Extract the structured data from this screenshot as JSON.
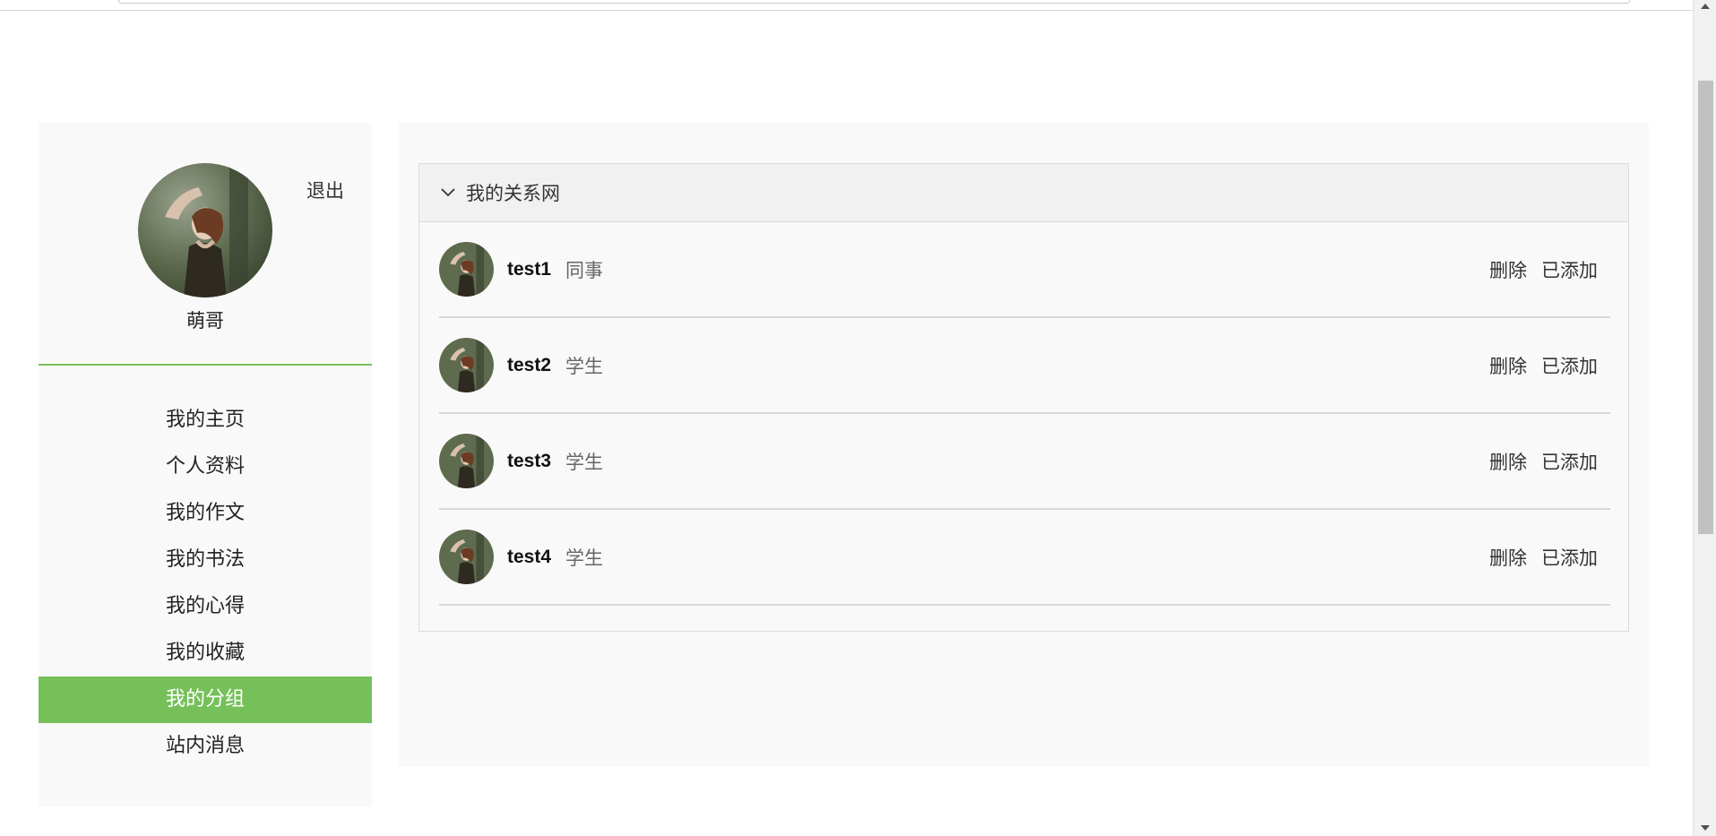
{
  "sidebar": {
    "logout_label": "退出",
    "username": "萌哥",
    "nav": [
      {
        "label": "我的主页",
        "active": false
      },
      {
        "label": "个人资料",
        "active": false
      },
      {
        "label": "我的作文",
        "active": false
      },
      {
        "label": "我的书法",
        "active": false
      },
      {
        "label": "我的心得",
        "active": false
      },
      {
        "label": "我的收藏",
        "active": false
      },
      {
        "label": "我的分组",
        "active": true
      },
      {
        "label": "站内消息",
        "active": false
      }
    ],
    "accent_color": "#76c05a"
  },
  "panel": {
    "title": "我的关系网",
    "rows": [
      {
        "name": "test1",
        "tag": "同事",
        "delete_label": "删除",
        "added_label": "已添加"
      },
      {
        "name": "test2",
        "tag": "学生",
        "delete_label": "删除",
        "added_label": "已添加"
      },
      {
        "name": "test3",
        "tag": "学生",
        "delete_label": "删除",
        "added_label": "已添加"
      },
      {
        "name": "test4",
        "tag": "学生",
        "delete_label": "删除",
        "added_label": "已添加"
      }
    ]
  }
}
